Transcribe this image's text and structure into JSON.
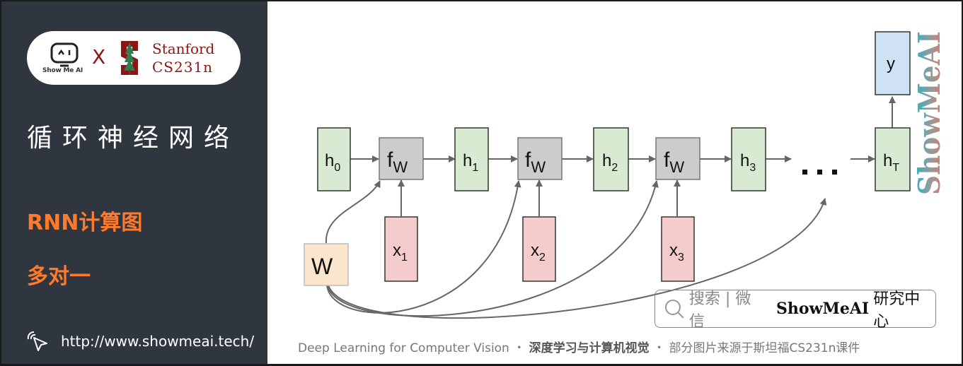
{
  "sidebar": {
    "brand_left": "Show Me AI",
    "cross": "X",
    "partner_name": "Stanford",
    "partner_course": "CS231n",
    "title": "循环神经网络",
    "section_1": "RNN计算图",
    "section_2": "多对一",
    "url": "http://www.showmeai.tech/",
    "accent_color": "#ff7a2a",
    "background_color": "#2f3640"
  },
  "diagram": {
    "hidden_states": [
      {
        "base": "h",
        "sub": "0"
      },
      {
        "base": "h",
        "sub": "1"
      },
      {
        "base": "h",
        "sub": "2"
      },
      {
        "base": "h",
        "sub": "3"
      },
      {
        "base": "h",
        "sub": "T"
      }
    ],
    "functions": [
      {
        "base": "f",
        "sub": "W"
      },
      {
        "base": "f",
        "sub": "W"
      },
      {
        "base": "f",
        "sub": "W"
      }
    ],
    "inputs": [
      {
        "base": "x",
        "sub": "1"
      },
      {
        "base": "x",
        "sub": "2"
      },
      {
        "base": "x",
        "sub": "3"
      }
    ],
    "weight": "W",
    "output": "y",
    "ellipsis": "...",
    "colors": {
      "hidden": "#d9ead3",
      "function": "#cccccc",
      "input": "#f4cccc",
      "weight": "#fce5cd",
      "output": "#cfe2f3",
      "arrow": "#666666"
    }
  },
  "search_box": {
    "hint": "搜索 | 微信",
    "brand": "ShowMeAI",
    "brand_suffix": "研究中心"
  },
  "watermark": "ShowMeAI",
  "footer": {
    "part1": "Deep Learning for Computer Vision",
    "separator": "・",
    "part2": "深度学习与计算机视觉",
    "part3": "部分图片来源于斯坦福CS231n课件"
  }
}
